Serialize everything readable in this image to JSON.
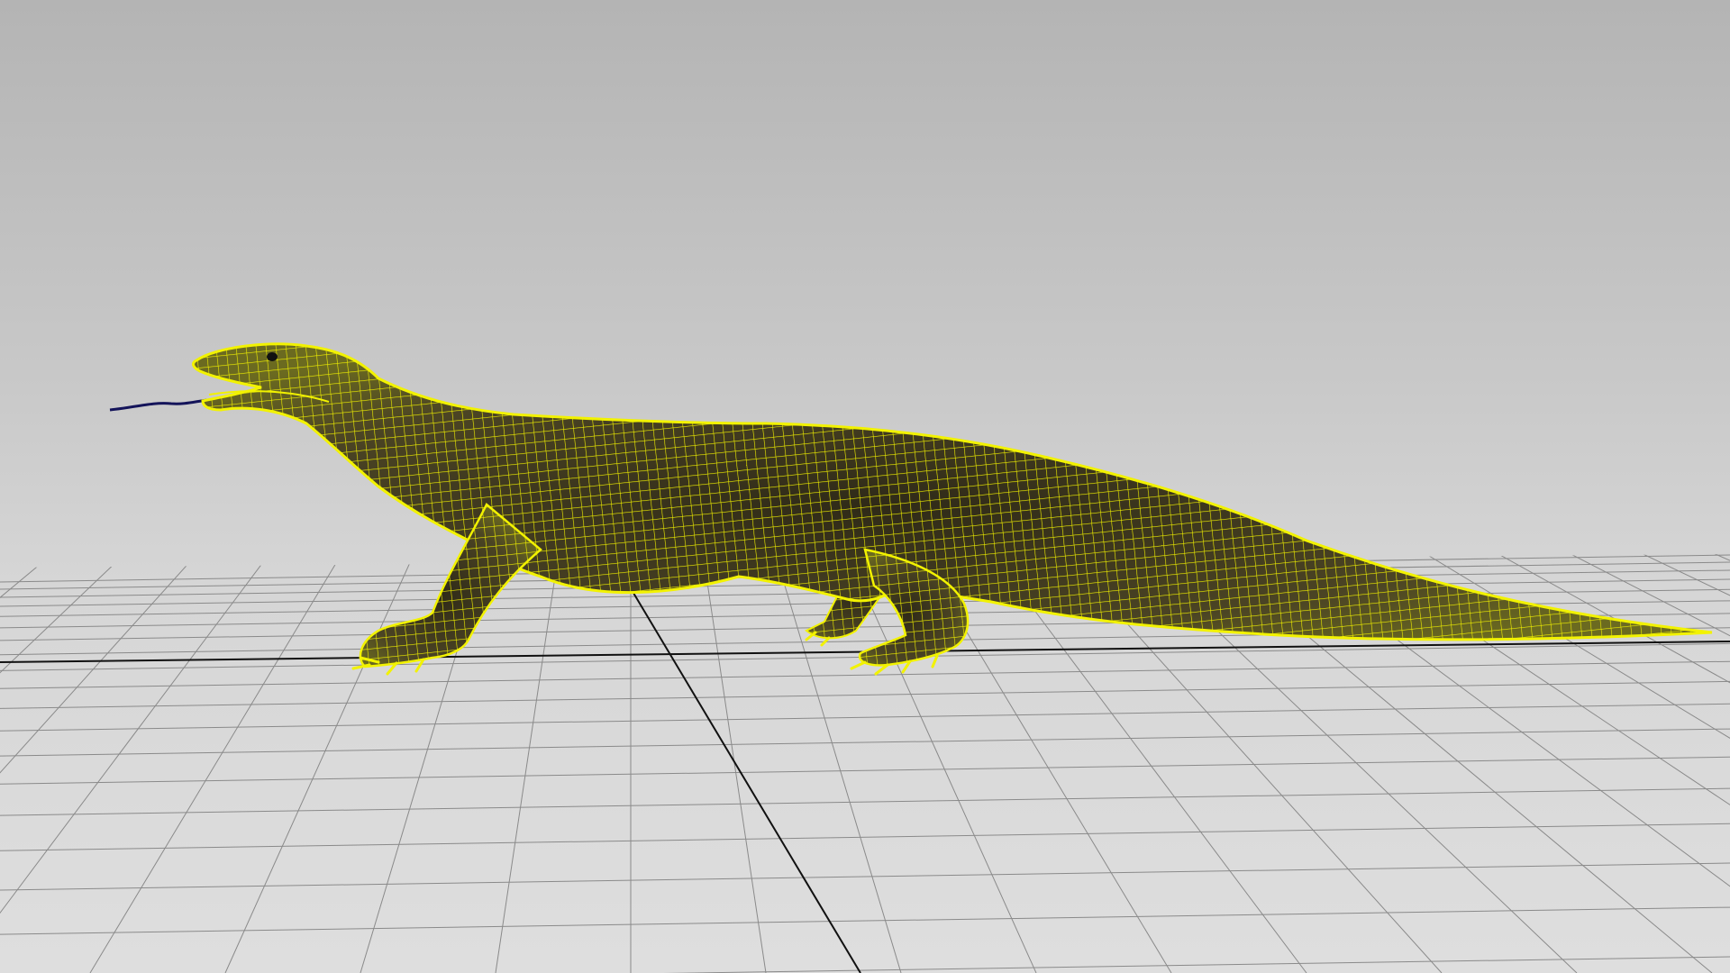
{
  "viewport": {
    "mode": "wireframe-on-shaded",
    "grid": true,
    "background_colors": [
      "#b4b4b4",
      "#dedede"
    ],
    "grid_color": "#8a8a8a",
    "axis_color": "#111111"
  },
  "model": {
    "subject": "monitor lizard",
    "selected": true,
    "wireframe_color": "#f2f200",
    "shade_color": "#3a3520",
    "tongue_color": "#14145a"
  }
}
